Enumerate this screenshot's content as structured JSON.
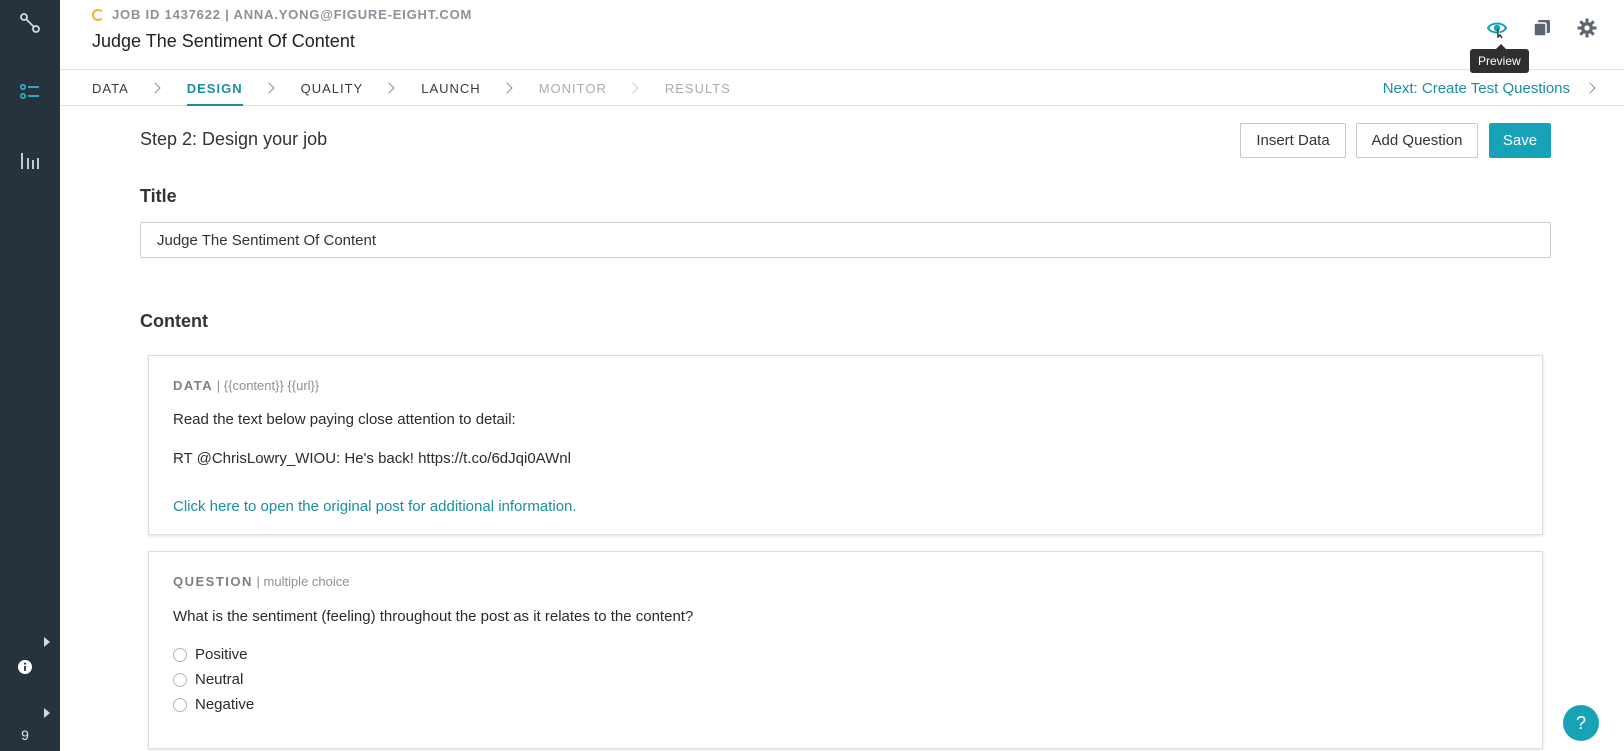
{
  "header": {
    "job_line": "JOB ID 1437622 | ANNA.YONG@FIGURE-EIGHT.COM",
    "title": "Judge The Sentiment Of Content",
    "preview_tooltip": "Preview"
  },
  "nav": {
    "tabs": [
      {
        "label": "DATA",
        "state": "done"
      },
      {
        "label": "DESIGN",
        "state": "active"
      },
      {
        "label": "QUALITY",
        "state": "done"
      },
      {
        "label": "LAUNCH",
        "state": "done"
      },
      {
        "label": "MONITOR",
        "state": "disabled"
      },
      {
        "label": "RESULTS",
        "state": "disabled"
      }
    ],
    "next_label": "Next: Create Test Questions"
  },
  "main": {
    "step_title": "Step 2: Design your job",
    "buttons": {
      "insert_data": "Insert Data",
      "add_question": "Add Question",
      "save": "Save"
    },
    "title_label": "Title",
    "title_value": "Judge The Sentiment Of Content",
    "content_label": "Content"
  },
  "data_card": {
    "kind": "DATA",
    "fields": " | {{content}} {{url}}",
    "instruction": "Read the text below paying close attention to detail:",
    "content": "RT @ChrisLowry_WIOU: He's back! https://t.co/6dJqi0AWnl",
    "link": "Click here to open the original post for additional information."
  },
  "question_card": {
    "kind": "QUESTION",
    "type": " | multiple choice",
    "prompt": "What is the sentiment (feeling) throughout the post as it relates to the content?",
    "options": [
      "Positive",
      "Neutral",
      "Negative"
    ]
  },
  "rail": {
    "counter": "9"
  },
  "help": {
    "label": "?"
  },
  "colors": {
    "accent": "#17a2b8",
    "rail": "#27333c",
    "link": "#1a8ea3",
    "refresh": "#f2b233"
  },
  "icons": {
    "rail": [
      "workflow-icon",
      "checklist-icon",
      "bar-chart-icon",
      "info-icon"
    ],
    "header": [
      "eye-icon",
      "copy-icon",
      "gear-icon"
    ]
  }
}
